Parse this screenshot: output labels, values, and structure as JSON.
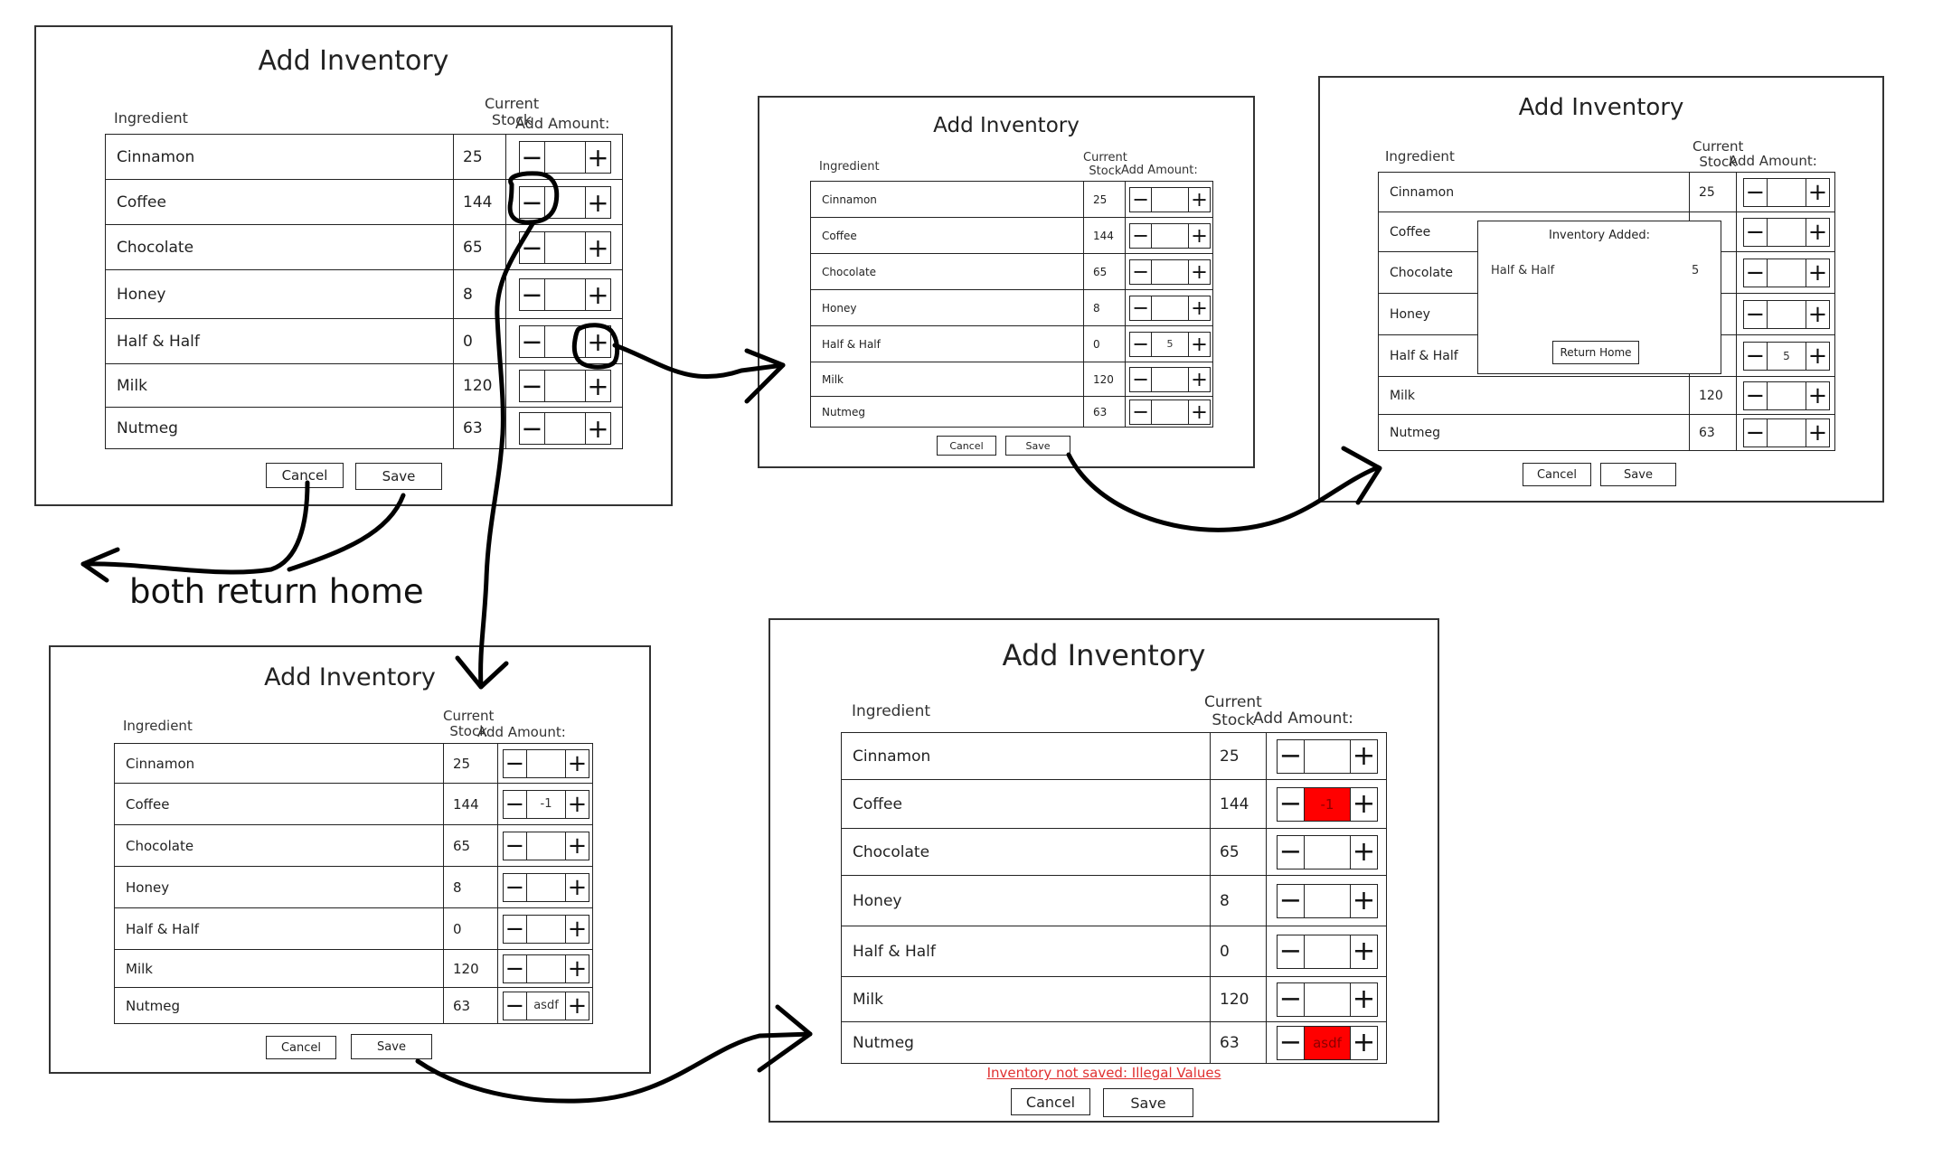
{
  "annotations": {
    "return_home_note": "both return home"
  },
  "mockups": [
    {
      "id": "m1",
      "title": "Add Inventory",
      "ingredient_header": "Ingredient",
      "stock_header": "Current\nStock",
      "amount_header": "Add Amount:",
      "rows": [
        {
          "name": "Cinnamon",
          "stock": "25",
          "amount": "",
          "invalid": false
        },
        {
          "name": "Coffee",
          "stock": "144",
          "amount": "",
          "invalid": false
        },
        {
          "name": "Chocolate",
          "stock": "65",
          "amount": "",
          "invalid": false
        },
        {
          "name": "Honey",
          "stock": "8",
          "amount": "",
          "invalid": false
        },
        {
          "name": "Half & Half",
          "stock": "0",
          "amount": "",
          "invalid": false
        },
        {
          "name": "Milk",
          "stock": "120",
          "amount": "",
          "invalid": false
        },
        {
          "name": "Nutmeg",
          "stock": "63",
          "amount": "",
          "invalid": false
        }
      ],
      "cancel_label": "Cancel",
      "save_label": "Save"
    },
    {
      "id": "m2",
      "title": "Add Inventory",
      "ingredient_header": "Ingredient",
      "stock_header": "Current\nStock",
      "amount_header": "Add Amount:",
      "rows": [
        {
          "name": "Cinnamon",
          "stock": "25",
          "amount": "",
          "invalid": false
        },
        {
          "name": "Coffee",
          "stock": "144",
          "amount": "",
          "invalid": false
        },
        {
          "name": "Chocolate",
          "stock": "65",
          "amount": "",
          "invalid": false
        },
        {
          "name": "Honey",
          "stock": "8",
          "amount": "",
          "invalid": false
        },
        {
          "name": "Half & Half",
          "stock": "0",
          "amount": "5",
          "invalid": false
        },
        {
          "name": "Milk",
          "stock": "120",
          "amount": "",
          "invalid": false
        },
        {
          "name": "Nutmeg",
          "stock": "63",
          "amount": "",
          "invalid": false
        }
      ],
      "cancel_label": "Cancel",
      "save_label": "Save"
    },
    {
      "id": "m3",
      "title": "Add Inventory",
      "ingredient_header": "Ingredient",
      "stock_header": "Current\nStock",
      "amount_header": "Add Amount:",
      "rows": [
        {
          "name": "Cinnamon",
          "stock": "25",
          "amount": "",
          "invalid": false
        },
        {
          "name": "Coffee",
          "stock": "",
          "amount": "",
          "invalid": false
        },
        {
          "name": "Chocolate",
          "stock": "",
          "amount": "",
          "invalid": false
        },
        {
          "name": "Honey",
          "stock": "",
          "amount": "",
          "invalid": false
        },
        {
          "name": "Half & Half",
          "stock": "",
          "amount": "5",
          "invalid": false
        },
        {
          "name": "Milk",
          "stock": "120",
          "amount": "",
          "invalid": false
        },
        {
          "name": "Nutmeg",
          "stock": "63",
          "amount": "",
          "invalid": false
        }
      ],
      "cancel_label": "Cancel",
      "save_label": "Save",
      "dialog": {
        "title": "Inventory Added:",
        "item_name": "Half & Half",
        "item_amount": "5",
        "button_label": "Return Home"
      }
    },
    {
      "id": "m4",
      "title": "Add Inventory",
      "ingredient_header": "Ingredient",
      "stock_header": "Current\nStock",
      "amount_header": "Add Amount:",
      "rows": [
        {
          "name": "Cinnamon",
          "stock": "25",
          "amount": "",
          "invalid": false
        },
        {
          "name": "Coffee",
          "stock": "144",
          "amount": "-1",
          "invalid": false
        },
        {
          "name": "Chocolate",
          "stock": "65",
          "amount": "",
          "invalid": false
        },
        {
          "name": "Honey",
          "stock": "8",
          "amount": "",
          "invalid": false
        },
        {
          "name": "Half & Half",
          "stock": "0",
          "amount": "",
          "invalid": false
        },
        {
          "name": "Milk",
          "stock": "120",
          "amount": "",
          "invalid": false
        },
        {
          "name": "Nutmeg",
          "stock": "63",
          "amount": "asdf",
          "invalid": false
        }
      ],
      "cancel_label": "Cancel",
      "save_label": "Save"
    },
    {
      "id": "m5",
      "title": "Add Inventory",
      "ingredient_header": "Ingredient",
      "stock_header": "Current\nStock",
      "amount_header": "Add Amount:",
      "rows": [
        {
          "name": "Cinnamon",
          "stock": "25",
          "amount": "",
          "invalid": false
        },
        {
          "name": "Coffee",
          "stock": "144",
          "amount": "-1",
          "invalid": true
        },
        {
          "name": "Chocolate",
          "stock": "65",
          "amount": "",
          "invalid": false
        },
        {
          "name": "Honey",
          "stock": "8",
          "amount": "",
          "invalid": false
        },
        {
          "name": "Half & Half",
          "stock": "0",
          "amount": "",
          "invalid": false
        },
        {
          "name": "Milk",
          "stock": "120",
          "amount": "",
          "invalid": false
        },
        {
          "name": "Nutmeg",
          "stock": "63",
          "amount": "asdf",
          "invalid": true
        }
      ],
      "error_message": "Inventory not saved: Illegal Values",
      "cancel_label": "Cancel",
      "save_label": "Save",
      "colors": {
        "error": "#ff0000",
        "error_text": "#e03030"
      }
    }
  ]
}
